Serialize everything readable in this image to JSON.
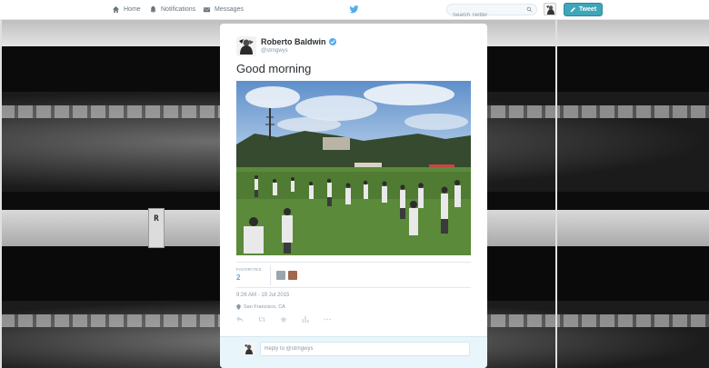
{
  "nav": {
    "home_label": "Home",
    "notifications_label": "Notifications",
    "messages_label": "Messages",
    "search_placeholder": "Search Twitter",
    "tweet_button_label": "Tweet"
  },
  "tweet": {
    "author_name": "Roberto Baldwin",
    "author_handle": "@strngwys",
    "text": "Good morning",
    "favorites_label": "FAVORITES",
    "favorites_count": "2",
    "timestamp": "9:26 AM - 19 Jul 2015",
    "location": "San Francisco, CA",
    "reply_placeholder": "Reply to @strngwys"
  },
  "background": {
    "marker_text": "R"
  },
  "colors": {
    "accent": "#55acee",
    "tweet_button": "#3fa6b9",
    "reply_area": "#e8f5fa"
  },
  "icons": {
    "home": "home-icon",
    "notifications": "bell-icon",
    "messages": "envelope-icon",
    "logo": "twitter-bird-icon",
    "search": "search-icon",
    "verified": "verified-badge-icon",
    "location": "location-pin-icon",
    "actions": [
      "reply-icon",
      "retweet-icon",
      "favorite-icon",
      "stats-icon",
      "more-icon"
    ]
  }
}
